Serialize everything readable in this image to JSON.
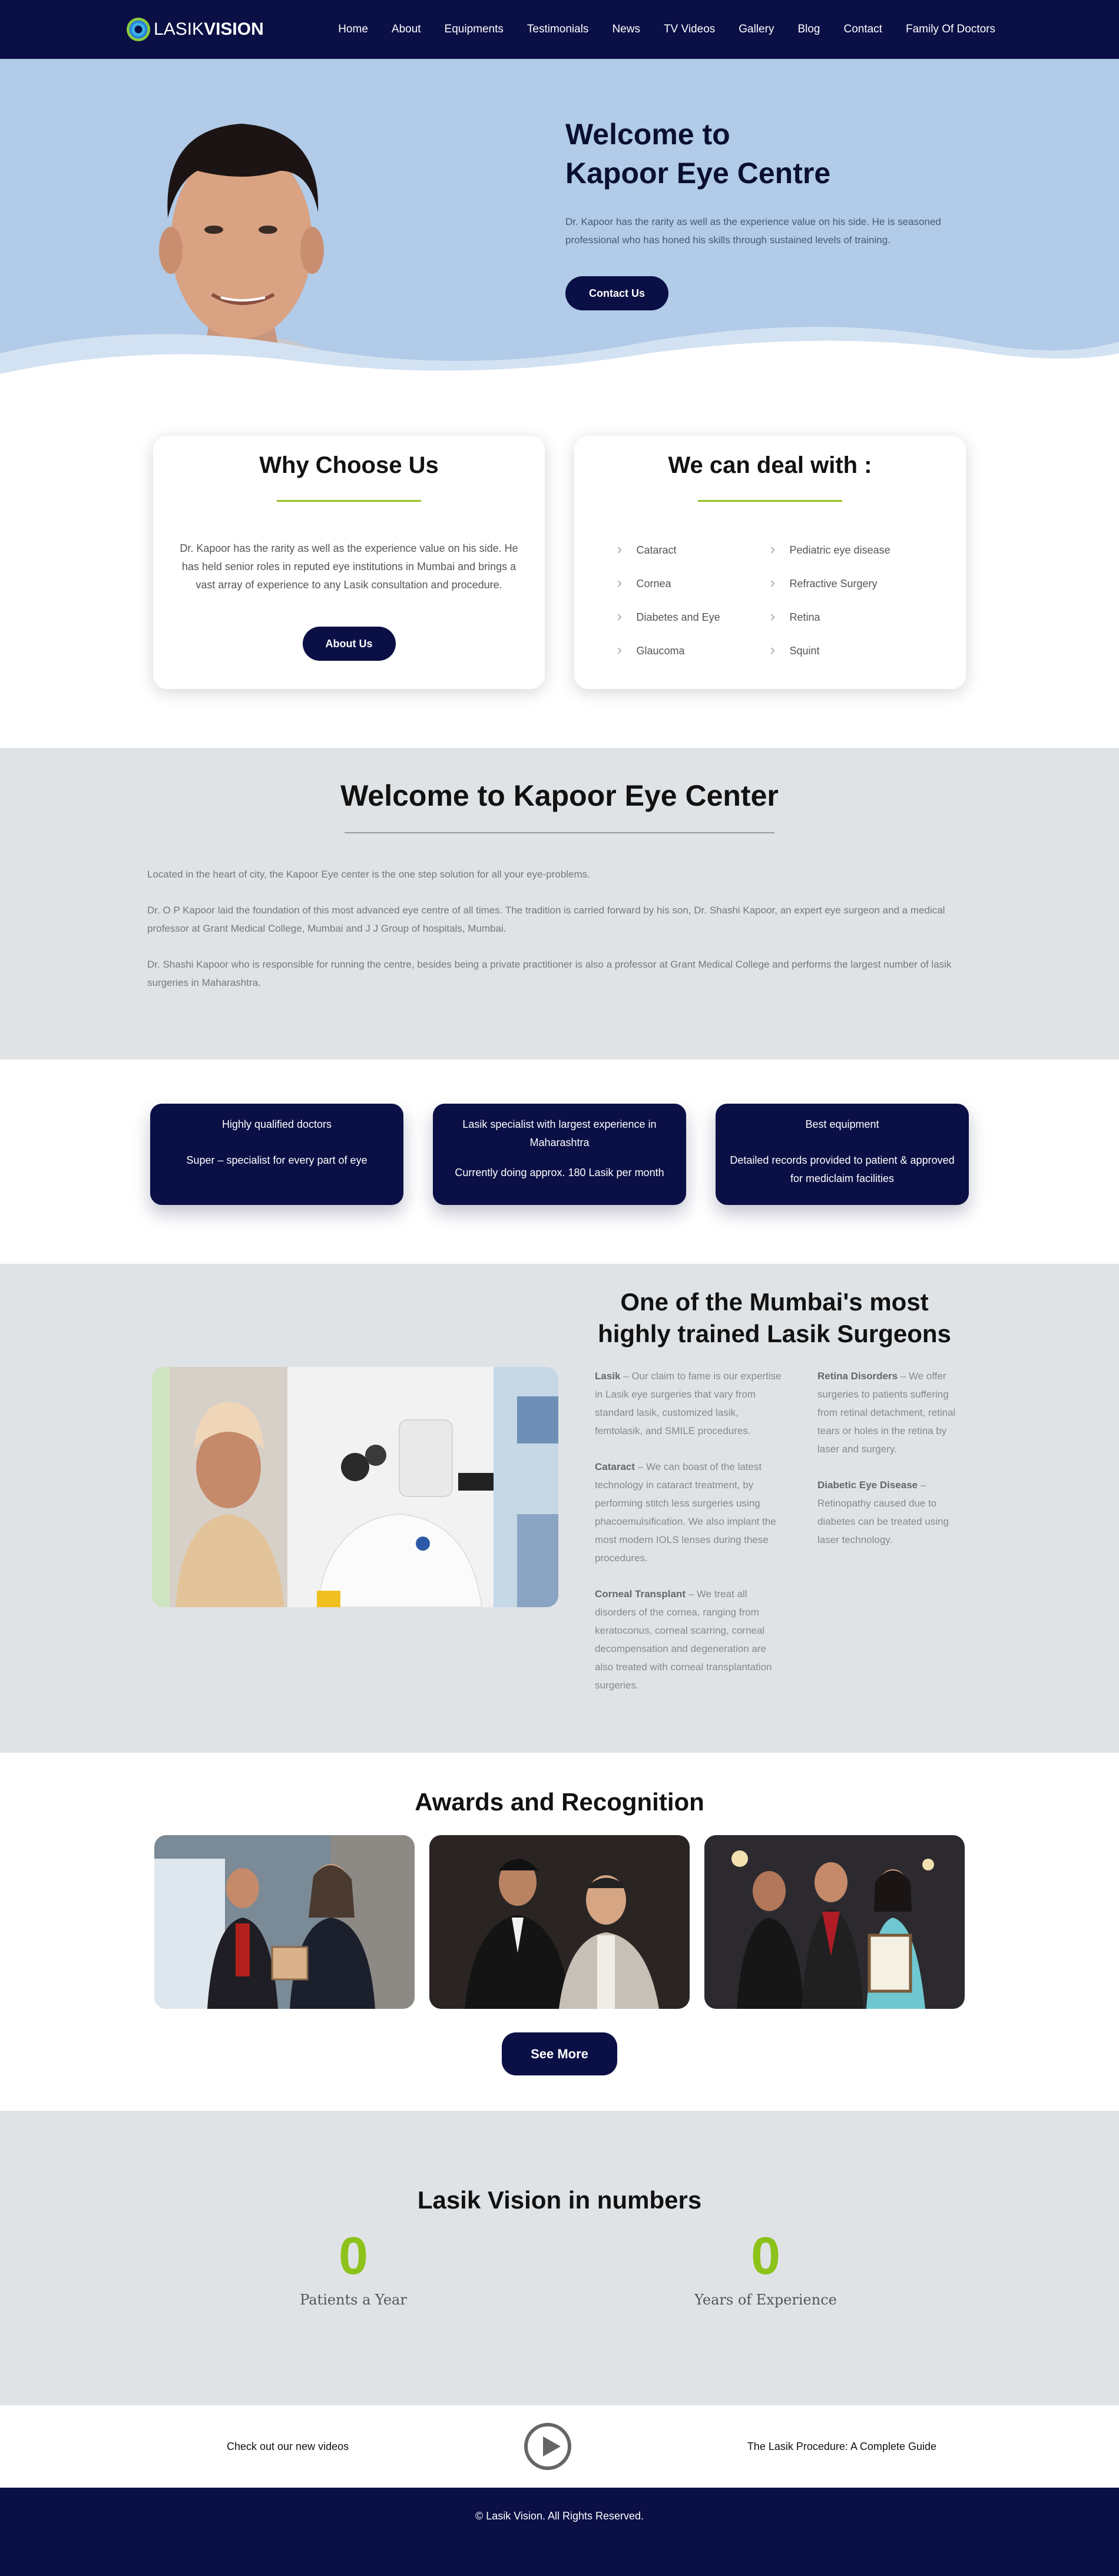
{
  "nav": {
    "logo_light": "LASIK",
    "logo_bold": "VISION",
    "items": [
      "Home",
      "About",
      "Equipments",
      "Testimonials",
      "News",
      "TV Videos",
      "Gallery",
      "Blog",
      "Contact",
      "Family Of Doctors"
    ]
  },
  "hero": {
    "title_line1": "Welcome to",
    "title_line2": "Kapoor Eye Centre",
    "text": "Dr. Kapoor has the rarity as well as the experience value on his side. He is seasoned professional who has honed his skills through sustained levels of training.",
    "button": "Contact Us"
  },
  "why": {
    "title": "Why Choose Us",
    "text": "Dr. Kapoor has the rarity as well as the experience value on his side. He has held senior roles in reputed eye institutions in Mumbai and brings a vast array of experience to any Lasik consultation and procedure.",
    "button": "About Us"
  },
  "deal": {
    "title": "We can deal with :",
    "items": [
      "Cataract",
      "Pediatric eye disease",
      "Cornea",
      "Refractive Surgery",
      "Diabetes and Eye",
      "Retina",
      "Glaucoma",
      "Squint"
    ]
  },
  "welcome": {
    "title": "Welcome to Kapoor Eye Center",
    "paragraphs": [
      "Located in the heart of city, the Kapoor Eye center is the one step solution for all your eye-problems.",
      "Dr. O P Kapoor laid the foundation of this most advanced eye centre of all times. The tradition is carried forward by his son, Dr. Shashi Kapoor, an expert eye surgeon and a medical professor at Grant Medical College, Mumbai and J J Group of hospitals, Mumbai.",
      "Dr. Shashi Kapoor who is responsible for running the centre, besides being a private practitioner is also a professor at Grant Medical College and performs the largest number of lasik surgeries in Maharashtra."
    ]
  },
  "features": [
    {
      "title": "Highly qualified doctors",
      "text": "Super – specialist for every part of eye"
    },
    {
      "title": "Lasik specialist with largest experience in Maharashtra",
      "text": "Currently doing approx. 180 Lasik per month"
    },
    {
      "title": "Best equipment",
      "text": "Detailed records provided to patient & approved for mediclaim facilities"
    }
  ],
  "surgeons": {
    "title": "One of the Mumbai's most highly trained Lasik Surgeons",
    "left": [
      {
        "name": "Lasik",
        "text": " – Our claim to fame is our expertise in Lasik eye surgeries that vary from standard lasik, customized lasik, femtolasik, and SMILE procedures."
      },
      {
        "name": "Cataract",
        "text": " – We can boast of the latest technology in cataract treatment, by performing stitch less surgeries using phacoemulsification. We also implant the most modern IOLS lenses during these procedures."
      },
      {
        "name": "Corneal Transplant",
        "text": " – We treat all disorders of the cornea, ranging from keratoconus, corneal scarring, corneal decompensation and degeneration are also treated with corneal transplantation surgeries."
      }
    ],
    "right": [
      {
        "name": "Retina Disorders",
        "text": " – We offer surgeries to patients suffering from retinal detachment, retinal tears or holes in the retina by laser and surgery."
      },
      {
        "name": "Diabetic Eye Disease",
        "text": " – Retinopathy caused due to diabetes can be treated using laser technology."
      }
    ]
  },
  "awards": {
    "title": "Awards and Recognition",
    "button": "See More"
  },
  "numbers": {
    "title": "Lasik Vision in numbers",
    "items": [
      {
        "value": "0",
        "label": "Patients a Year"
      },
      {
        "value": "0",
        "label": "Years of Experience"
      }
    ]
  },
  "videos": {
    "left": "Check out our new videos",
    "right": "The Lasik Procedure: A Complete Guide"
  },
  "footer": {
    "text": "© Lasik Vision. All Rights Reserved."
  },
  "colors": {
    "navy": "#0a0f45",
    "accent_green": "#8cc21a",
    "hero_bg": "#b1cbe8",
    "section_grey": "#e0e3e6"
  }
}
